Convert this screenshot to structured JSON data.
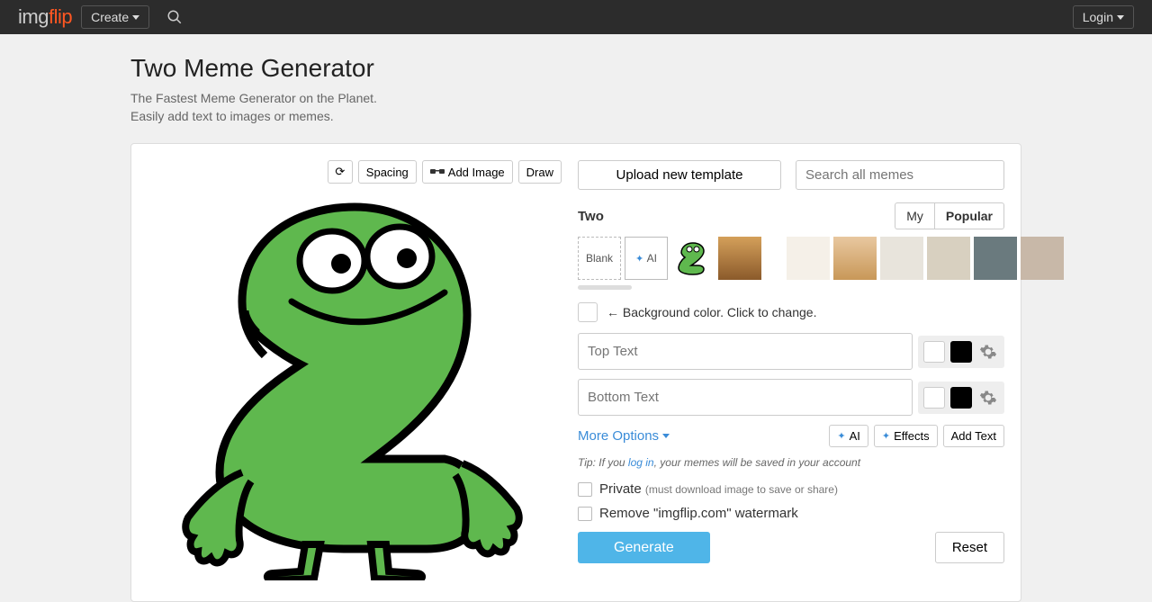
{
  "nav": {
    "logo_img": "img",
    "logo_flip": "flip",
    "create": "Create",
    "login": "Login"
  },
  "header": {
    "title": "Two Meme Generator",
    "subtitle": "The Fastest Meme Generator on the Planet. Easily add text to images or memes."
  },
  "toolbar": {
    "rotate_label": "⟳",
    "spacing": "Spacing",
    "add_image": "Add Image",
    "draw": "Draw"
  },
  "right": {
    "upload": "Upload new template",
    "search_placeholder": "Search all memes",
    "template_name": "Two",
    "tab_my": "My",
    "tab_popular": "Popular",
    "blank": "Blank",
    "ai_tile": "AI",
    "bgcolor_hint": "← Background color. Click to change.",
    "top_placeholder": "Top Text",
    "bottom_placeholder": "Bottom Text",
    "more_options": "More Options",
    "ai_btn": "AI",
    "effects_btn": "Effects",
    "add_text_btn": "Add Text",
    "tip_prefix": "Tip: If you ",
    "tip_link": "log in",
    "tip_suffix": ", your memes will be saved in your account",
    "private": "Private",
    "private_note": "(must download image to save or share)",
    "watermark": "Remove \"imgflip.com\" watermark",
    "generate": "Generate",
    "reset": "Reset"
  }
}
